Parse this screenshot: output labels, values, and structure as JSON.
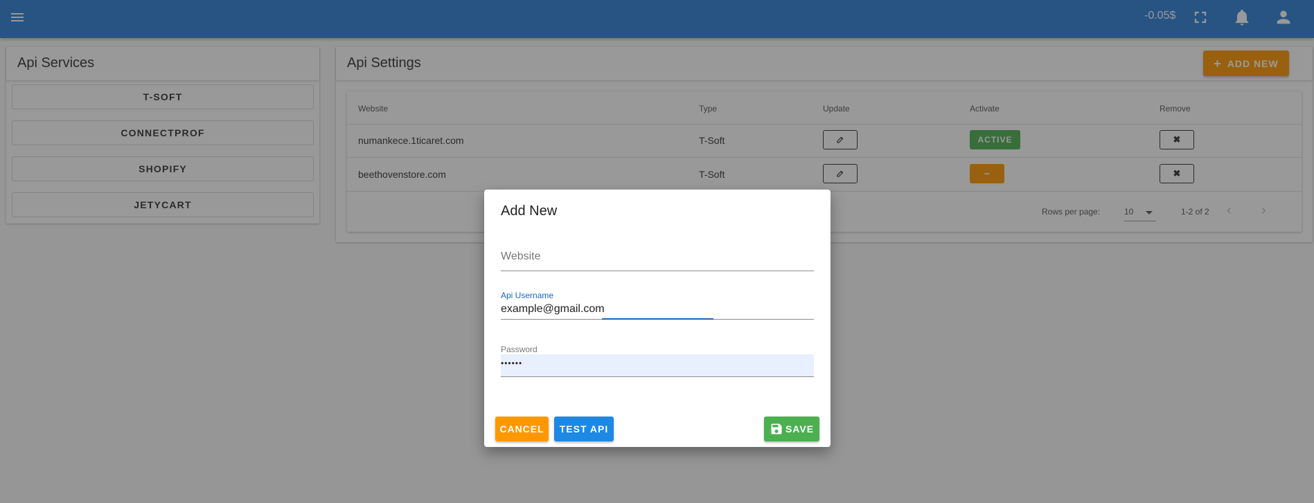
{
  "topbar": {
    "menu_icon": "hamburger-menu-icon",
    "balance": "-0.05$",
    "icons": [
      "fullscreen-icon",
      "bell-icon",
      "account-icon"
    ],
    "color": "#2f80d8"
  },
  "services_panel": {
    "title": "Api Services",
    "items": [
      "T-SOFT",
      "CONNECTPROF",
      "SHOPIFY",
      "JETYCART"
    ]
  },
  "settings_panel": {
    "title": "Api Settings",
    "add_new_label": "ADD NEW",
    "table": {
      "headers": [
        "Website",
        "Type",
        "Update",
        "Activate",
        "Remove"
      ],
      "rows": [
        {
          "website": "numankece.1ticaret.com",
          "type": "T-Soft",
          "activate": "ACTIVE",
          "active": true
        },
        {
          "website": "beethovenstore.com",
          "type": "T-Soft",
          "activate": "−",
          "active": false
        }
      ]
    },
    "pagination": {
      "rows_per_page_label": "Rows per page:",
      "rows_per_page_value": "10",
      "range": "1-2 of 2"
    }
  },
  "dialog": {
    "title": "Add New",
    "website": {
      "placeholder": "Website",
      "value": ""
    },
    "api_username": {
      "label": "Api Username",
      "value": "example@gmail.com"
    },
    "password": {
      "label": "Password",
      "value": "••••••"
    },
    "buttons": {
      "cancel": "CANCEL",
      "test": "TEST API",
      "save": "SAVE"
    },
    "colors": {
      "cancel": "#ff9800",
      "test": "#1e88e5",
      "save": "#4caf50",
      "focus": "#1565c0"
    }
  }
}
